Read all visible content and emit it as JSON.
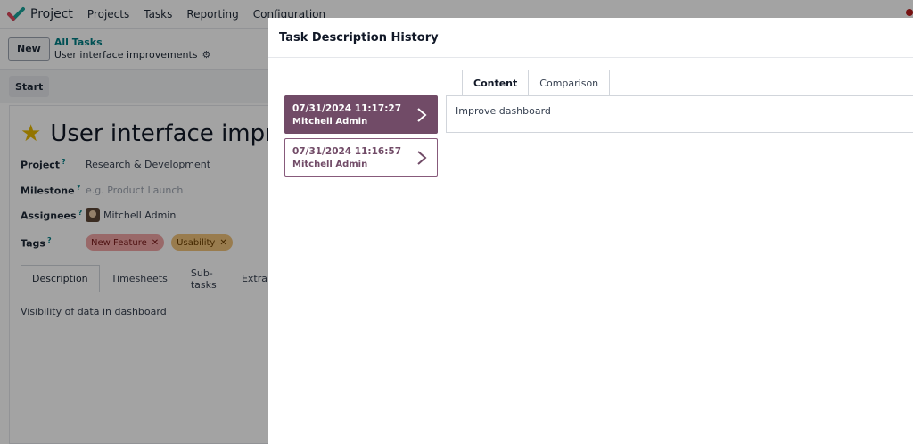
{
  "navbar": {
    "app_name": "Project",
    "menu": [
      "Projects",
      "Tasks",
      "Reporting",
      "Configuration"
    ]
  },
  "control_panel": {
    "new_label": "New",
    "breadcrumb_parent": "All Tasks",
    "breadcrumb_current": "User interface improvements"
  },
  "statusbar": {
    "start_label": "Start"
  },
  "form": {
    "title": "User interface impro",
    "project_label": "Project",
    "project_value": "Research & Development",
    "milestone_label": "Milestone",
    "milestone_placeholder": "e.g. Product Launch",
    "assignees_label": "Assignees",
    "assignee_name": "Mitchell Admin",
    "tags_label": "Tags",
    "help_mark": "?",
    "tags": [
      {
        "label": "New Feature",
        "color": "#f0a5a5"
      },
      {
        "label": "Usability",
        "color": "#f0c27a"
      }
    ],
    "tabs": [
      "Description",
      "Timesheets",
      "Sub-tasks",
      "Extra"
    ],
    "description": "Visibility of data in dashboard"
  },
  "modal": {
    "title": "Task Description History",
    "revisions": [
      {
        "date": "07/31/2024 11:17:27",
        "user": "Mitchell Admin",
        "active": true
      },
      {
        "date": "07/31/2024 11:16:57",
        "user": "Mitchell Admin",
        "active": false
      }
    ],
    "tabs": [
      "Content",
      "Comparison"
    ],
    "content_text": "Improve dashboard"
  },
  "colors": {
    "primary": "#714b67",
    "link": "#017e84"
  }
}
